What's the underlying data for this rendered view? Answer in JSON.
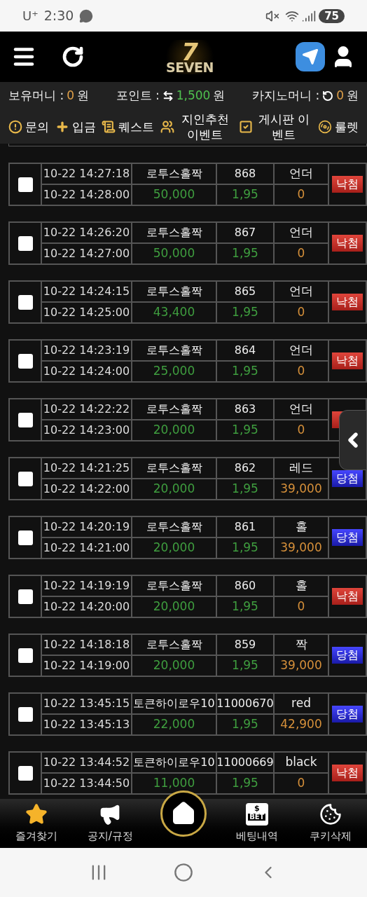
{
  "status_bar": {
    "carrier": "U⁺",
    "time": "2:30",
    "battery": "75"
  },
  "header": {
    "logo_number": "7",
    "logo_text": "SEVEN"
  },
  "balances": [
    {
      "label": "보유머니 :",
      "value": "0",
      "unit": "원",
      "kind": "plain"
    },
    {
      "label": "포인트 :",
      "value": "1,500",
      "unit": "원",
      "kind": "exchange"
    },
    {
      "label": "카지노머니 :",
      "value": "0",
      "unit": "원",
      "kind": "refresh"
    }
  ],
  "menu": [
    {
      "label": "문의",
      "kind": "alert"
    },
    {
      "label": "입금",
      "kind": "plus"
    },
    {
      "label": "퀘스트",
      "kind": "scroll"
    },
    {
      "label": "지인추천 이벤트",
      "kind": "people"
    },
    {
      "label": "게시판 이벤트",
      "kind": "board"
    },
    {
      "label": "룰렛",
      "kind": "wheel"
    }
  ],
  "bets": [
    {
      "checked": false,
      "bet_time": "10-22 14:27:18",
      "settle_time": "10-22 14:28:00",
      "game": "로투스홀짝",
      "round": "868",
      "pick": "언더",
      "amount": "50,000",
      "odds": "1,95",
      "payout": "0",
      "result": {
        "kind": "lose",
        "label": "낙첨"
      }
    },
    {
      "checked": false,
      "bet_time": "10-22 14:26:20",
      "settle_time": "10-22 14:27:00",
      "game": "로투스홀짝",
      "round": "867",
      "pick": "언더",
      "amount": "50,000",
      "odds": "1,95",
      "payout": "0",
      "result": {
        "kind": "lose",
        "label": "낙첨"
      }
    },
    {
      "checked": false,
      "bet_time": "10-22 14:24:15",
      "settle_time": "10-22 14:25:00",
      "game": "로투스홀짝",
      "round": "865",
      "pick": "언더",
      "amount": "43,400",
      "odds": "1,95",
      "payout": "0",
      "result": {
        "kind": "lose",
        "label": "낙첨"
      }
    },
    {
      "checked": false,
      "bet_time": "10-22 14:23:19",
      "settle_time": "10-22 14:24:00",
      "game": "로투스홀짝",
      "round": "864",
      "pick": "언더",
      "amount": "25,000",
      "odds": "1,95",
      "payout": "0",
      "result": {
        "kind": "lose",
        "label": "낙첨"
      }
    },
    {
      "checked": false,
      "bet_time": "10-22 14:22:22",
      "settle_time": "10-22 14:23:00",
      "game": "로투스홀짝",
      "round": "863",
      "pick": "언더",
      "amount": "20,000",
      "odds": "1,95",
      "payout": "0",
      "result": {
        "kind": "lose"
      }
    },
    {
      "checked": false,
      "bet_time": "10-22 14:21:25",
      "settle_time": "10-22 14:22:00",
      "game": "로투스홀짝",
      "round": "862",
      "pick": "레드",
      "amount": "20,000",
      "odds": "1,95",
      "payout": "39,000",
      "result": {
        "kind": "win",
        "label": "당첨"
      }
    },
    {
      "checked": false,
      "bet_time": "10-22 14:20:19",
      "settle_time": "10-22 14:21:00",
      "game": "로투스홀짝",
      "round": "861",
      "pick": "홀",
      "amount": "20,000",
      "odds": "1,95",
      "payout": "39,000",
      "result": {
        "kind": "win",
        "label": "당첨"
      }
    },
    {
      "checked": false,
      "bet_time": "10-22 14:19:19",
      "settle_time": "10-22 14:20:00",
      "game": "로투스홀짝",
      "round": "860",
      "pick": "홀",
      "amount": "20,000",
      "odds": "1,95",
      "payout": "0",
      "result": {
        "kind": "lose",
        "label": "낙첨"
      }
    },
    {
      "checked": false,
      "bet_time": "10-22 14:18:18",
      "settle_time": "10-22 14:19:00",
      "game": "로투스홀짝",
      "round": "859",
      "pick": "짝",
      "amount": "20,000",
      "odds": "1,95",
      "payout": "39,000",
      "result": {
        "kind": "win",
        "label": "당첨"
      }
    },
    {
      "checked": false,
      "bet_time": "10-22 13:45:15",
      "settle_time": "10-22 13:45:13",
      "game": "토큰하이로우10",
      "round": "11000670",
      "pick": "red",
      "amount": "22,000",
      "odds": "1,95",
      "payout": "42,900",
      "result": {
        "kind": "win",
        "label": "당첨"
      }
    },
    {
      "checked": false,
      "bet_time": "10-22 13:44:52",
      "settle_time": "10-22 13:44:50",
      "game": "토큰하이로우10",
      "round": "11000669",
      "pick": "black",
      "amount": "11,000",
      "odds": "1,95",
      "payout": "0",
      "result": {
        "kind": "lose",
        "label": "낙첨"
      }
    }
  ],
  "bottom_nav": [
    {
      "label": "즐겨찾기",
      "kind": "star"
    },
    {
      "label": "공지/규정",
      "kind": "megaphone"
    },
    {
      "kind": "home"
    },
    {
      "label": "베팅내역",
      "kind": "bet",
      "icon_symbol": "$",
      "icon_text": "BET"
    },
    {
      "label": "쿠키삭제",
      "kind": "cookie"
    }
  ]
}
